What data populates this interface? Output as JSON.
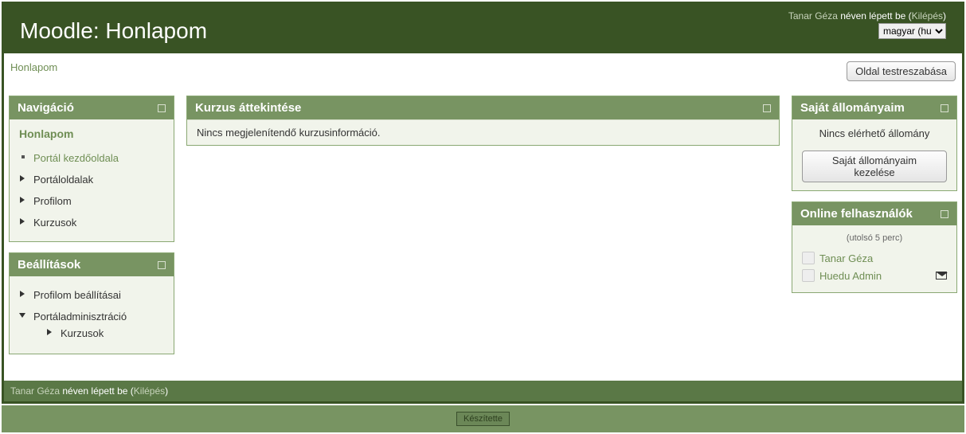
{
  "header": {
    "title": "Moodle: Honlapom",
    "user_name": "Tanar Géza",
    "logged_in_text": " néven lépett be (",
    "logout_label": "Kilépés",
    "close_paren": ")",
    "lang_selected": "magyar (hu)"
  },
  "breadcrumb": {
    "current": "Honlapom",
    "customize_btn": "Oldal testreszabása"
  },
  "nav_block": {
    "title": "Navigáció",
    "root": "Honlapom",
    "items": [
      {
        "label": "Portál kezdőoldala",
        "kind": "link",
        "icon": "square"
      },
      {
        "label": "Portáloldalak",
        "kind": "text",
        "icon": "tri"
      },
      {
        "label": "Profilom",
        "kind": "text",
        "icon": "tri"
      },
      {
        "label": "Kurzusok",
        "kind": "text",
        "icon": "tri"
      }
    ]
  },
  "settings_block": {
    "title": "Beállítások",
    "items": [
      {
        "label": "Profilom beállításai",
        "icon": "tri"
      },
      {
        "label": "Portáladminisztráció",
        "icon": "tri-down",
        "children": [
          {
            "label": "Kurzusok",
            "icon": "tri"
          }
        ]
      }
    ]
  },
  "course_block": {
    "title": "Kurzus áttekintése",
    "empty_text": "Nincs megjelenítendő kurzusinformáció."
  },
  "files_block": {
    "title": "Saját állományaim",
    "empty_text": "Nincs elérhető állomány",
    "manage_btn": "Saját állományaim kezelése"
  },
  "online_block": {
    "title": "Online felhasználók",
    "subtitle": "(utolsó 5 perc)",
    "users": [
      {
        "name": "Tanar Géza",
        "has_msg": false
      },
      {
        "name": "Huedu Admin",
        "has_msg": true
      }
    ]
  },
  "footer": {
    "user_name": "Tanar Géza",
    "logged_in_text": " néven lépett be (",
    "logout_label": "Kilépés",
    "close_paren": ")"
  },
  "bottom": {
    "label": "Készítette"
  }
}
